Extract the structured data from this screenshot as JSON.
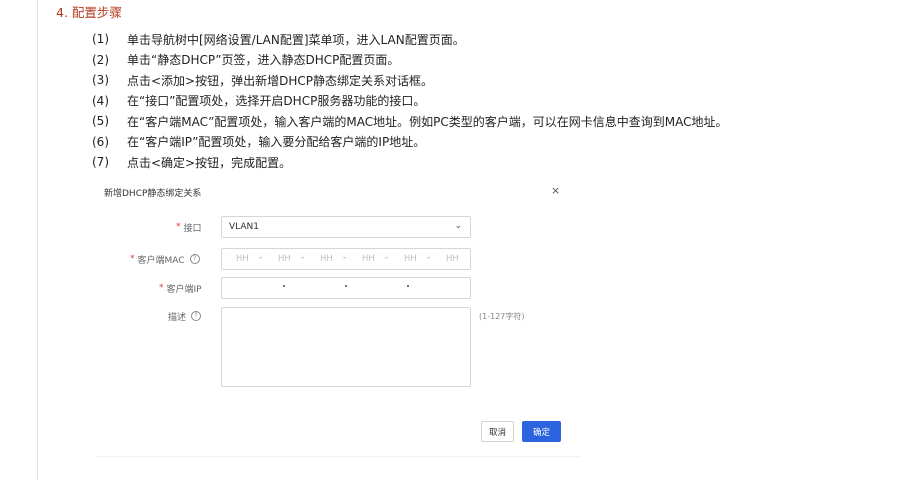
{
  "section_title": "4. 配置步骤",
  "steps": [
    {
      "num": "(1)",
      "text": "单击导航树中[网络设置/LAN配置]菜单项，进入LAN配置页面。"
    },
    {
      "num": "(2)",
      "text": "单击“静态DHCP”页签，进入静态DHCP配置页面。"
    },
    {
      "num": "(3)",
      "text": "点击<添加>按钮，弹出新增DHCP静态绑定关系对话框。"
    },
    {
      "num": "(4)",
      "text": "在“接口”配置项处，选择开启DHCP服务器功能的接口。"
    },
    {
      "num": "(5)",
      "text": "在“客户端MAC”配置项处，输入客户端的MAC地址。例如PC类型的客户端，可以在网卡信息中查询到MAC地址。"
    },
    {
      "num": "(6)",
      "text": "在“客户端IP”配置项处，输入要分配给客户端的IP地址。"
    },
    {
      "num": "(7)",
      "text": "点击<确定>按钮，完成配置。"
    }
  ],
  "dialog": {
    "title": "新增DHCP静态绑定关系",
    "close_glyph": "×",
    "required_mark": "*",
    "help_glyph": "?",
    "interface_label": "接口",
    "interface_value": "VLAN1",
    "select_chevron": "⌄",
    "mac_label": "客户端MAC",
    "mac_placeholder": "HH",
    "mac_separator": "-",
    "ip_label": "客户端IP",
    "desc_label": "描述",
    "desc_hint": "(1-127字符)",
    "cancel_label": "取消",
    "ok_label": "确定"
  },
  "colors": {
    "section_title": "#b23b1e",
    "required": "#e03535",
    "primary_button": "#2c64e0"
  }
}
